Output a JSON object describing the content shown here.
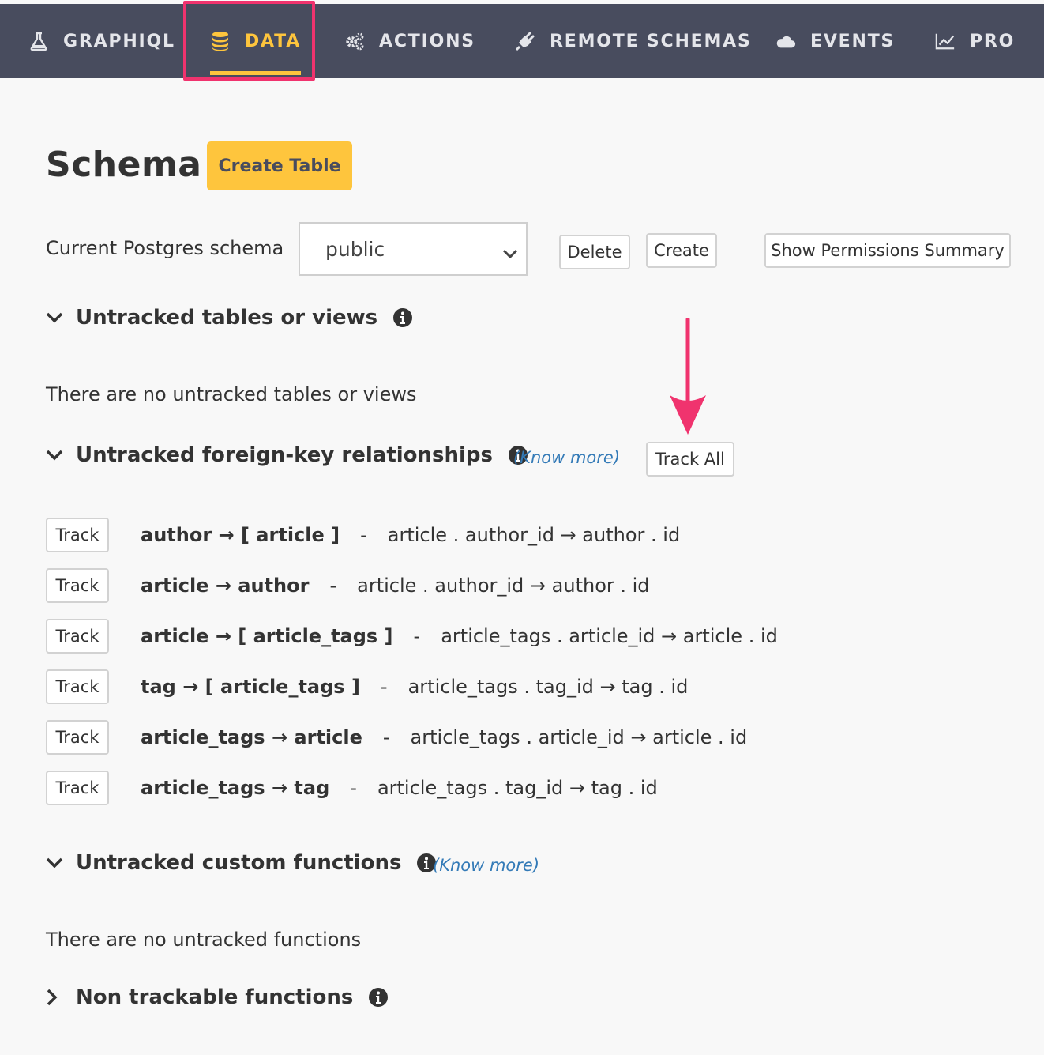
{
  "nav": {
    "items": [
      {
        "label": "GRAPHIQL",
        "icon": "flask-icon",
        "active": false
      },
      {
        "label": "DATA",
        "icon": "database-icon",
        "active": true
      },
      {
        "label": "ACTIONS",
        "icon": "gears-icon",
        "active": false
      },
      {
        "label": "REMOTE SCHEMAS",
        "icon": "plug-icon",
        "active": false
      },
      {
        "label": "EVENTS",
        "icon": "cloud-icon",
        "active": false
      },
      {
        "label": "PRO",
        "icon": "chart-line-icon",
        "active": false
      }
    ]
  },
  "header": {
    "title": "Schema",
    "create_table_label": "Create Table"
  },
  "schema_select": {
    "label": "Current Postgres schema",
    "value": "public",
    "delete_label": "Delete",
    "create_label": "Create",
    "permissions_label": "Show Permissions Summary"
  },
  "untracked_tables": {
    "heading": "Untracked tables or views",
    "empty_text": "There are no untracked tables or views"
  },
  "untracked_fk": {
    "heading": "Untracked foreign-key relationships",
    "know_more": "(Know more)",
    "track_all_label": "Track All",
    "rows": [
      {
        "track": "Track",
        "name": "author → [ article ]",
        "sep": "-",
        "mapping": "article . author_id  →  author . id"
      },
      {
        "track": "Track",
        "name": "article → author",
        "sep": "-",
        "mapping": "article . author_id  →  author . id"
      },
      {
        "track": "Track",
        "name": "article → [ article_tags ]",
        "sep": "-",
        "mapping": "article_tags . article_id  →  article . id"
      },
      {
        "track": "Track",
        "name": "tag → [ article_tags ]",
        "sep": "-",
        "mapping": "article_tags . tag_id  →  tag . id"
      },
      {
        "track": "Track",
        "name": "article_tags → article",
        "sep": "-",
        "mapping": "article_tags . article_id  →  article . id"
      },
      {
        "track": "Track",
        "name": "article_tags → tag",
        "sep": "-",
        "mapping": "article_tags . tag_id  →  tag . id"
      }
    ]
  },
  "untracked_functions": {
    "heading": "Untracked custom functions",
    "know_more": "(Know more)",
    "empty_text": "There are no untracked functions"
  },
  "non_trackable": {
    "heading": "Non trackable functions"
  },
  "colors": {
    "nav_bg": "#484c5e",
    "accent_yellow": "#fec53d",
    "highlight_pink": "#f0336e",
    "link_blue": "#337ab7"
  }
}
